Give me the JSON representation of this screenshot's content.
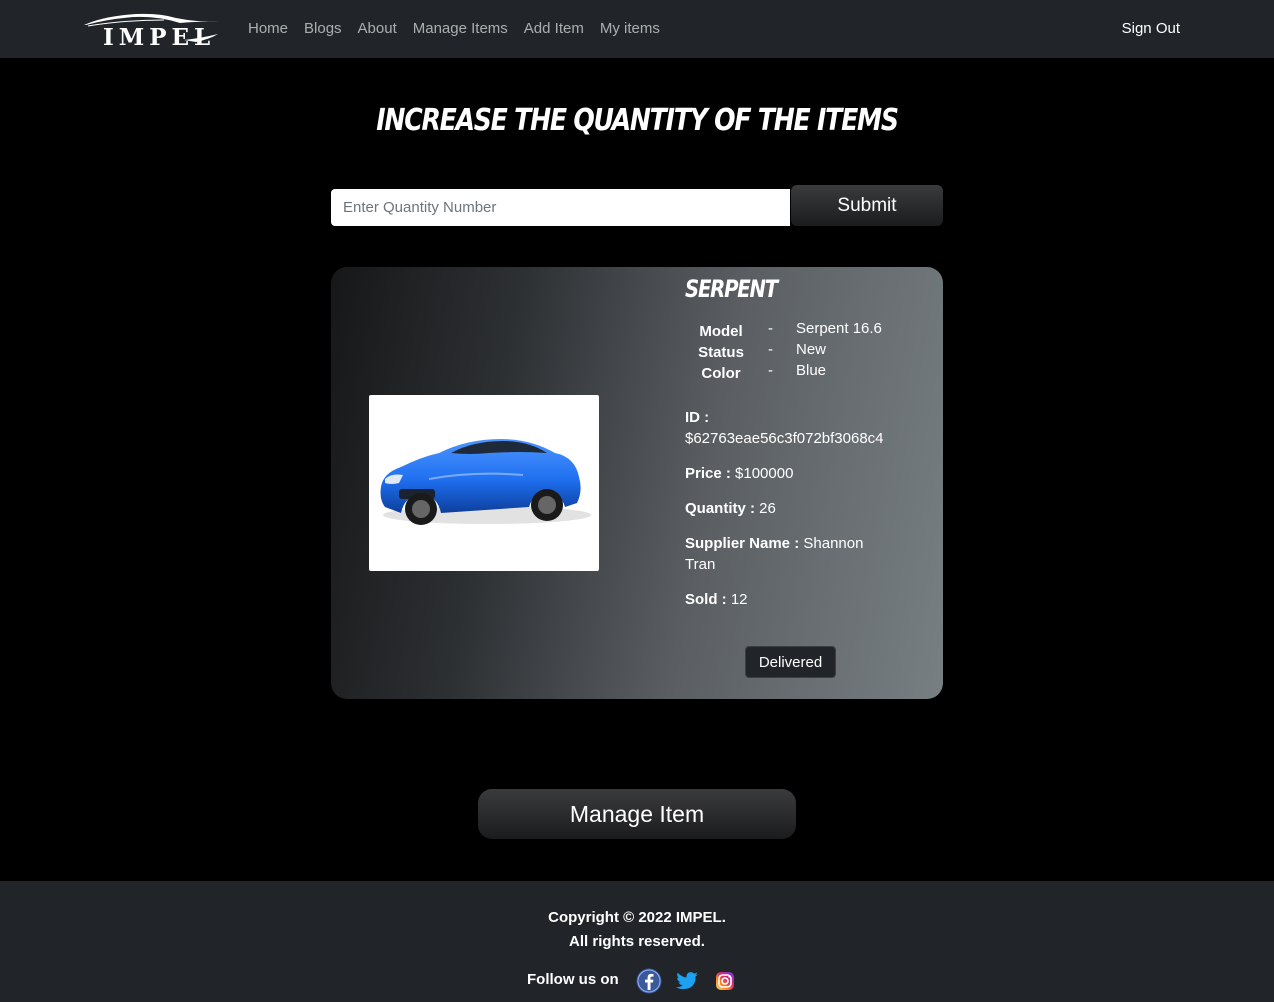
{
  "nav": {
    "brand": "IMPEL",
    "links": [
      "Home",
      "Blogs",
      "About",
      "Manage Items",
      "Add Item",
      "My items"
    ],
    "sign_out": "Sign Out"
  },
  "page": {
    "heading": "Increase the Quantity of the items"
  },
  "form": {
    "placeholder": "Enter Quantity Number",
    "submit_label": "Submit"
  },
  "item": {
    "name": "Serpent",
    "specs": [
      {
        "label": "Model",
        "dash": "-",
        "value": "Serpent 16.6"
      },
      {
        "label": "Status",
        "dash": "-",
        "value": "New"
      },
      {
        "label": "Color",
        "dash": "-",
        "value": "Blue"
      }
    ],
    "id_label": "ID :",
    "id_value": "$62763eae56c3f072bf3068c4",
    "price_label": "Price :",
    "price_value": "$100000",
    "quantity_label": "Quantity :",
    "quantity_value": "26",
    "supplier_label": "Supplier Name :",
    "supplier_value": "Shannon Tran",
    "sold_label": "Sold :",
    "sold_value": "12",
    "delivered_label": "Delivered",
    "image_icon": "blue-sports-car"
  },
  "manage_label": "Manage Item",
  "footer": {
    "copyright": "Copyright © 2022 IMPEL.",
    "rights": "All rights reserved.",
    "follow": "Follow us on",
    "social_icons": [
      "facebook-icon",
      "twitter-icon",
      "instagram-icon"
    ]
  },
  "colors": {
    "navbar": "#212529",
    "background": "#000000",
    "car_blue": "#1f6ff0",
    "facebook": "#3b5998",
    "twitter": "#1da1f2"
  }
}
